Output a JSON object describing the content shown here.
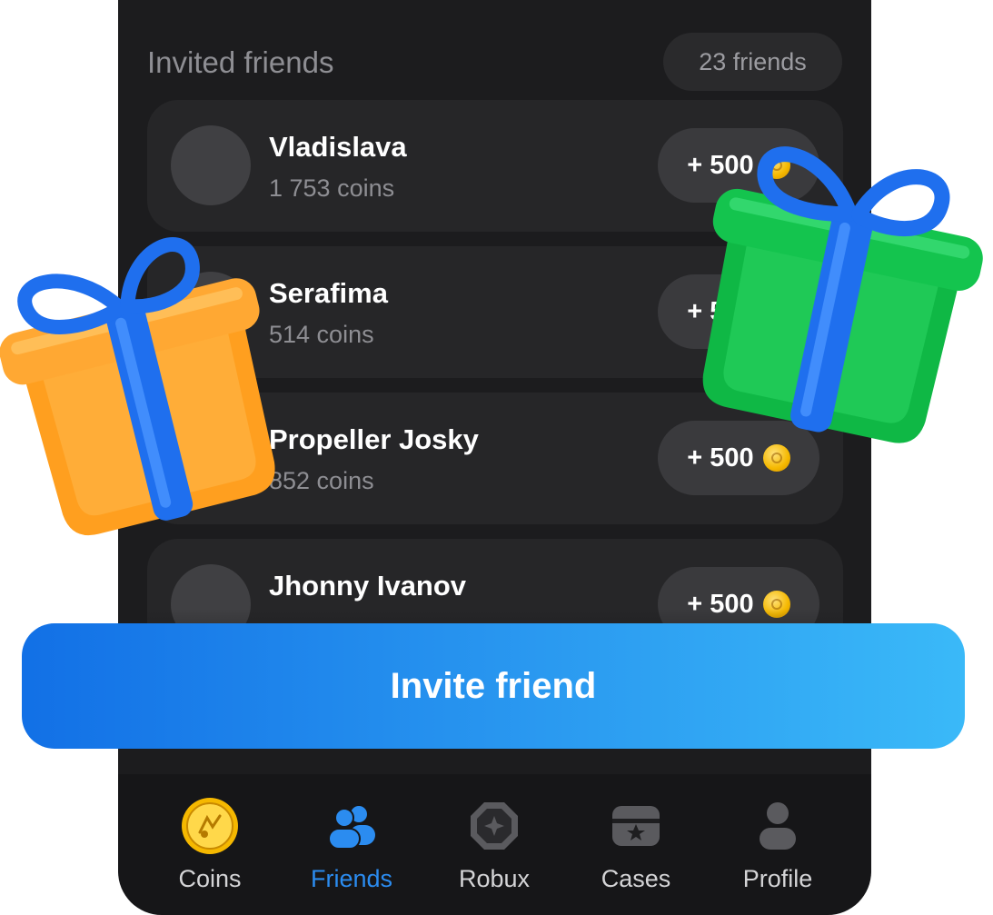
{
  "section": {
    "title": "Invited friends",
    "count": "23 friends"
  },
  "friends": [
    {
      "name": "Vladislava",
      "coins": "1 753 coins",
      "reward": "+ 500"
    },
    {
      "name": "Serafima",
      "coins": "514 coins",
      "reward": "+ 500"
    },
    {
      "name": "Propeller Josky",
      "coins": "852 coins",
      "reward": "+ 500"
    },
    {
      "name": "Jhonny Ivanov",
      "coins": "",
      "reward": "+ 500"
    }
  ],
  "invite_button": {
    "label": "Invite friend"
  },
  "tabs": [
    {
      "label": "Coins",
      "icon": "coin-icon",
      "active": false
    },
    {
      "label": "Friends",
      "icon": "friends-icon",
      "active": true
    },
    {
      "label": "Robux",
      "icon": "robux-icon",
      "active": false
    },
    {
      "label": "Cases",
      "icon": "case-icon",
      "active": false
    },
    {
      "label": "Profile",
      "icon": "profile-icon",
      "active": false
    }
  ],
  "colors": {
    "accent": "#2b8cf0",
    "background": "#1c1c1e",
    "card": "#262628",
    "gift_orange": "#ffa833",
    "gift_green": "#14c44e",
    "ribbon_blue": "#1f6fee"
  }
}
